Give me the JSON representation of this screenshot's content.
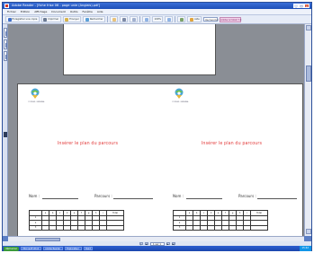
{
  "window": {
    "title": "Adobe Reader - [fiche frise 06 - page unie (Anglais).pdf]",
    "buttons": [
      "_",
      "□",
      "×"
    ]
  },
  "menubar": {
    "items": [
      "Fichier",
      "Edition",
      "Affichage",
      "Document",
      "Outils",
      "Fenêtre",
      "Aide"
    ]
  },
  "toolbar": {
    "save_label": "Enregistrer une copie",
    "print_label": "Imprimer",
    "email_label": "Envoyer",
    "search_label": "Rechercher",
    "zoom_value": "100%",
    "help_label": "Aide",
    "search_placeholder": "Rechercher",
    "promo_text": "Adobe Acrobat 7.0"
  },
  "document": {
    "logo_caption": "CONSEIL GENERAL",
    "course_title": "Insérer le plan du parcours",
    "nom_label": "Nom :",
    "parcours_label": "Parcours :",
    "table_header": [
      "",
      "a",
      "b",
      "c",
      "d",
      "e",
      "f",
      "g",
      "h",
      "i",
      "Total"
    ],
    "table_rows": [
      "1",
      "2",
      "3"
    ]
  },
  "statusbar": {
    "page_indicator": "1 sur 1",
    "nav": [
      "|◀",
      "◀",
      "▶",
      "▶|"
    ]
  },
  "taskbar": {
    "start_label": "démarrer",
    "tasks": [
      "Microsoft Word",
      "Adobe Reader",
      "Explorateur",
      "Paint"
    ],
    "clock": "15:42"
  },
  "colors": {
    "accent": "#e23b3b",
    "frame": "#5b7ec4",
    "doc_bg": "#8a8e95"
  }
}
